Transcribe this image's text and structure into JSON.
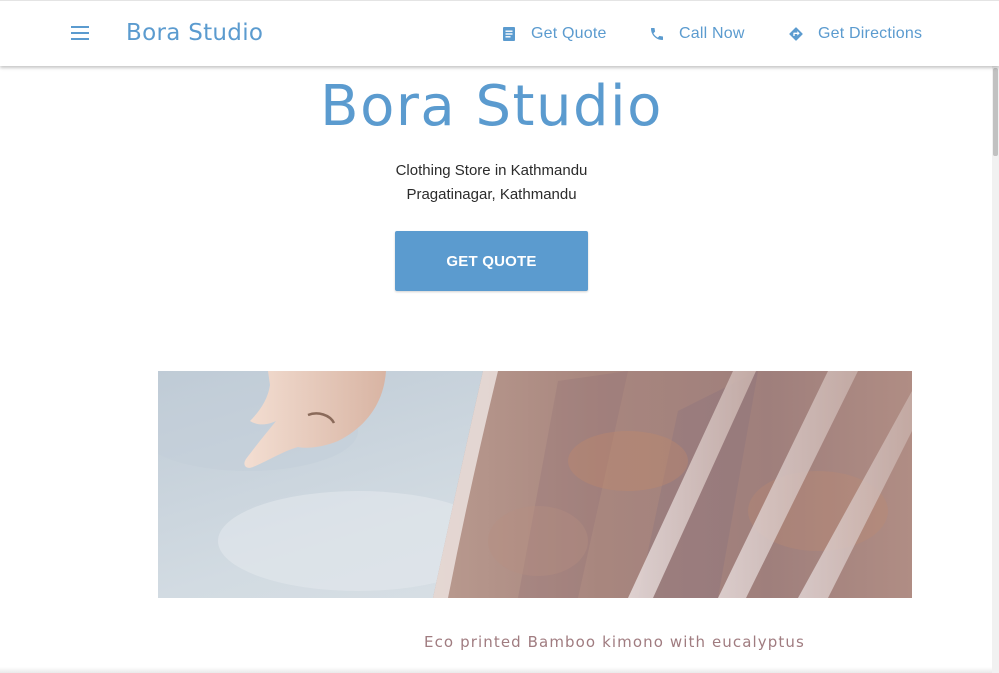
{
  "header": {
    "brand": "Bora Studio",
    "nav": [
      {
        "label": "Get Quote",
        "icon": "quote-icon"
      },
      {
        "label": "Call Now",
        "icon": "phone-icon"
      },
      {
        "label": "Get Directions",
        "icon": "directions-icon"
      }
    ]
  },
  "hero": {
    "title": "Bora Studio",
    "subtitle": "Clothing Store in Kathmandu",
    "location": "Pragatinagar, Kathmandu",
    "cta_label": "GET QUOTE"
  },
  "gallery": {
    "caption": "Eco printed Bamboo kimono with eucalyptus"
  },
  "colors": {
    "accent": "#5b9bcf",
    "caption": "#a07c80",
    "text": "#2b2b2b"
  }
}
